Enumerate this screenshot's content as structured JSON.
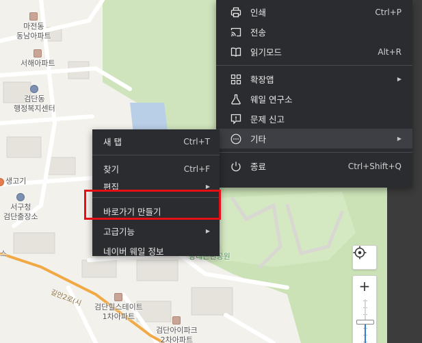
{
  "map": {
    "pois": [
      {
        "name": "마전동\n동남아파트",
        "kind": "bld"
      },
      {
        "name": "서해아파트",
        "kind": "bld"
      },
      {
        "name": "검단동\n행정복지센터",
        "kind": "gov"
      },
      {
        "name": "생고기",
        "kind": "store"
      },
      {
        "name": "서구청\n검단출장소",
        "kind": "gov"
      },
      {
        "name": "검단힐스테이트\n1차아파트",
        "kind": "bld"
      },
      {
        "name": "검단아이파크\n2차아파트",
        "kind": "bld"
      },
      {
        "name": "능내근린공원",
        "kind": "park"
      },
      {
        "name": "스",
        "kind": "gov"
      }
    ],
    "road_label": "길안2로(시",
    "zoom_in_label": "+",
    "zoom_level_fraction": 0.45
  },
  "main_menu": {
    "items": [
      {
        "icon": "print-icon",
        "label": "인쇄",
        "shortcut": "Ctrl+P"
      },
      {
        "icon": "cast-icon",
        "label": "전송",
        "shortcut": ""
      },
      {
        "icon": "reader-mode-icon",
        "label": "읽기모드",
        "shortcut": "Alt+R"
      },
      {
        "icon": "extensions-icon",
        "label": "확장앱",
        "shortcut": "",
        "submenu": true
      },
      {
        "icon": "labs-flask-icon",
        "label": "웨일 연구소",
        "shortcut": ""
      },
      {
        "icon": "report-icon",
        "label": "문제 신고",
        "shortcut": ""
      },
      {
        "icon": "more-icon",
        "label": "기타",
        "shortcut": "",
        "submenu": true
      },
      {
        "icon": "power-icon",
        "label": "종료",
        "shortcut": "Ctrl+Shift+Q"
      }
    ]
  },
  "sub_menu": {
    "items": [
      {
        "label": "새 탭",
        "shortcut": "Ctrl+T"
      },
      {
        "label": "찾기",
        "shortcut": "Ctrl+F"
      },
      {
        "label": "편집",
        "shortcut": "",
        "submenu": true
      },
      {
        "label": "바로가기 만들기",
        "shortcut": ""
      },
      {
        "label": "고급기능",
        "shortcut": "",
        "submenu": true
      },
      {
        "label": "네이버 웨일 정보",
        "shortcut": ""
      }
    ]
  },
  "colors": {
    "menu_bg": "#2b2c30",
    "menu_hover": "#3e3f44",
    "highlight": "#e40f17",
    "map_bg": "#f2f0ea",
    "park": "#c8dfb2",
    "water": "#b7cde6",
    "road_main": "#f1a944"
  }
}
